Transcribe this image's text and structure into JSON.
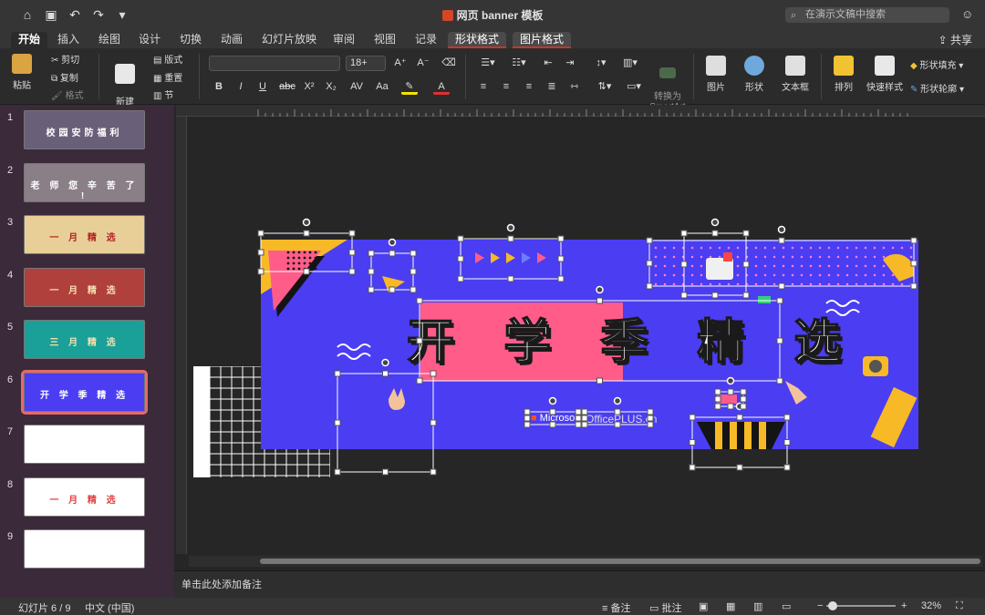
{
  "window": {
    "title": "网页 banner 模板",
    "search_placeholder": "在演示文稿中搜索"
  },
  "tabs": [
    {
      "label": "开始",
      "state": "active"
    },
    {
      "label": "插入"
    },
    {
      "label": "绘图"
    },
    {
      "label": "设计"
    },
    {
      "label": "切换"
    },
    {
      "label": "动画"
    },
    {
      "label": "幻灯片放映"
    },
    {
      "label": "审阅"
    },
    {
      "label": "视图"
    },
    {
      "label": "记录"
    },
    {
      "label": "形状格式",
      "state": "context"
    },
    {
      "label": "图片格式",
      "state": "context"
    }
  ],
  "share_label": "共享",
  "ribbon": {
    "paste": "粘贴",
    "cut": "剪切",
    "copy": "复制",
    "format": "格式",
    "new_slide": "新建\n幻灯片",
    "layout": "版式",
    "reset": "重置",
    "section": "节",
    "font_size": "18+",
    "convert_smartart": "转换为\nSmartArt",
    "picture": "图片",
    "shapes": "形状",
    "textbox": "文本框",
    "arrange": "排列",
    "quick_styles": "快速样式",
    "shape_fill": "形状填充",
    "shape_outline": "形状轮廓",
    "bold": "B",
    "italic": "I",
    "underline": "U",
    "strike": "abc",
    "superscript": "X²",
    "subscript": "X₂",
    "char_spacing": "AV",
    "case": "Aa"
  },
  "thumbnails": [
    {
      "num": "1",
      "text": "校园安防福利",
      "bg": "#6a5f78"
    },
    {
      "num": "2",
      "text": "老 师 您 辛 苦 了 !",
      "bg": "#8a7f86"
    },
    {
      "num": "3",
      "text": "一 月 精 选",
      "bg": "#e8cf98",
      "fg": "#b22222"
    },
    {
      "num": "4",
      "text": "一 月 精 选",
      "bg": "#b0403c",
      "fg": "#f6e0b0"
    },
    {
      "num": "5",
      "text": "三 月 精 选",
      "bg": "#1aa098",
      "fg": "#f6e0b0"
    },
    {
      "num": "6",
      "text": "开 学 季 精 选",
      "bg": "#4a3df2",
      "fg": "#ffffff"
    },
    {
      "num": "7",
      "text": "",
      "bg": "#ffffff"
    },
    {
      "num": "8",
      "text": "一 月 精 选",
      "bg": "#ffffff",
      "fg": "#e04040"
    },
    {
      "num": "9",
      "text": "",
      "bg": "#ffffff"
    }
  ],
  "slide": {
    "headline": "开 学 季 精 选",
    "logo_text": "Microsoft",
    "brand_text": "OfficePLUS.cn"
  },
  "notes_placeholder": "单击此处添加备注",
  "status": {
    "slide_indicator": "幻灯片 6 / 9",
    "language": "中文 (中国)",
    "notes": "备注",
    "comments": "批注",
    "zoom": "32%"
  },
  "colors": {
    "slide_bg": "#4a3df2",
    "accent_pink": "#ff5c8a",
    "thumb_panel": "#3b2a39",
    "selection_outline": "#e46a6a"
  }
}
